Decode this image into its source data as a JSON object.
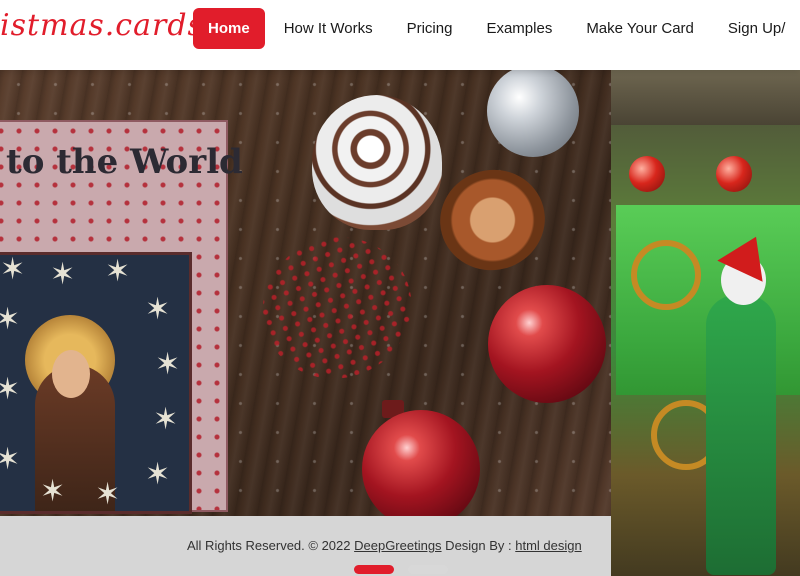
{
  "brand": {
    "logo_text": "istmas.cards"
  },
  "nav": {
    "items": [
      {
        "label": "Home",
        "active": true
      },
      {
        "label": "How It Works"
      },
      {
        "label": "Pricing"
      },
      {
        "label": "Examples"
      },
      {
        "label": "Make Your Card"
      },
      {
        "label": "Sign Up/"
      }
    ]
  },
  "slide": {
    "card_title": "to the World"
  },
  "footer": {
    "prefix": "All Rights Reserved. © 2022 ",
    "company_link": "DeepGreetings",
    "middle": " Design By : ",
    "designer_link": "html design"
  },
  "carousel": {
    "slide_count": 2,
    "active_index": 0
  },
  "colors": {
    "accent": "#e11d2b",
    "footer_bg": "#d6d6d6"
  }
}
